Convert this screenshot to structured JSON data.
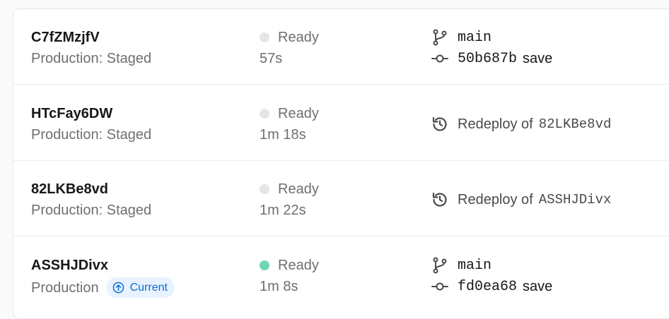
{
  "deployments": [
    {
      "id": "C7fZMzjfV",
      "environment": "Production: Staged",
      "status": "Ready",
      "status_color": "#e5e5e5",
      "duration": "57s",
      "source": {
        "type": "git",
        "branch": "main",
        "commit": "50b687b",
        "message": "save"
      }
    },
    {
      "id": "HTcFay6DW",
      "environment": "Production: Staged",
      "status": "Ready",
      "status_color": "#e5e5e5",
      "duration": "1m 18s",
      "source": {
        "type": "redeploy",
        "label": "Redeploy of",
        "ref": "82LKBe8vd"
      }
    },
    {
      "id": "82LKBe8vd",
      "environment": "Production: Staged",
      "status": "Ready",
      "status_color": "#e5e5e5",
      "duration": "1m 22s",
      "source": {
        "type": "redeploy",
        "label": "Redeploy of",
        "ref": "ASSHJDivx"
      }
    },
    {
      "id": "ASSHJDivx",
      "environment": "Production",
      "badge": "Current",
      "status": "Ready",
      "status_color": "#6fd6b5",
      "duration": "1m 8s",
      "source": {
        "type": "git",
        "branch": "main",
        "commit": "fd0ea68",
        "message": "save"
      }
    }
  ],
  "icons": {
    "branch": "git-branch-icon",
    "commit": "git-commit-icon",
    "redeploy": "redeploy-icon",
    "current": "arrow-up-circle-icon"
  }
}
